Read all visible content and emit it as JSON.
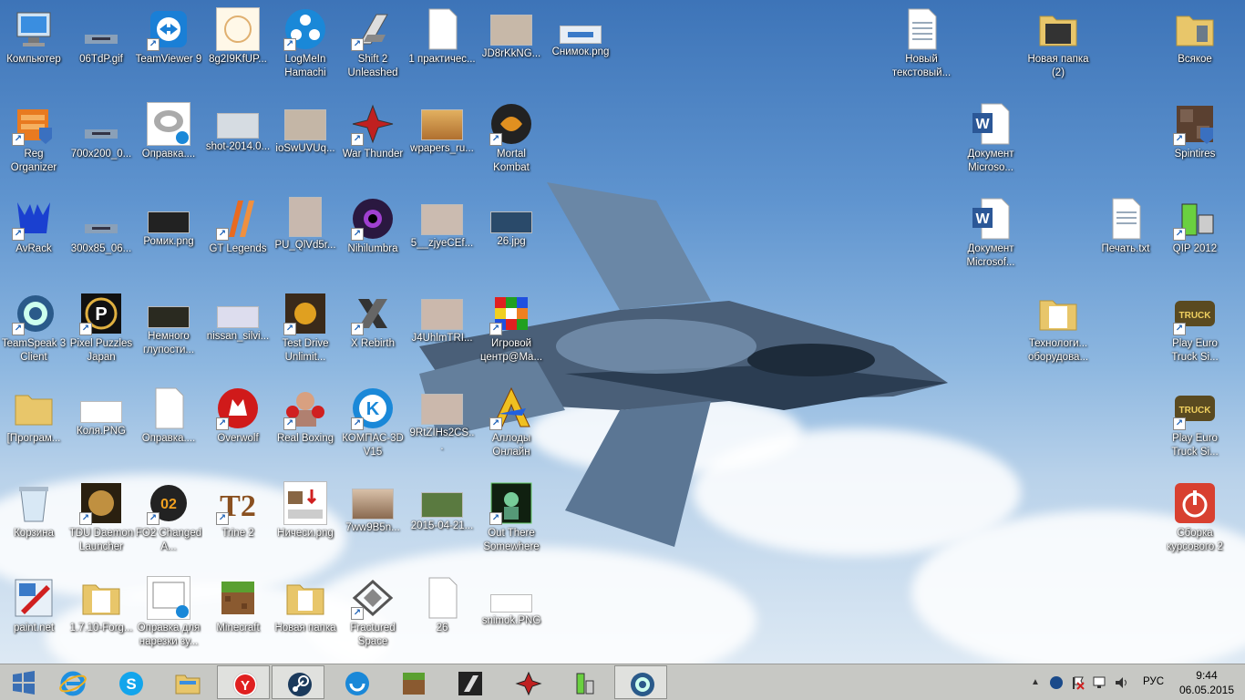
{
  "desktop": {
    "icons": [
      {
        "label": "Компьютер"
      },
      {
        "label": "06TdP.gif"
      },
      {
        "label": "TeamViewer 9"
      },
      {
        "label": "8g2I9KfUP..."
      },
      {
        "label": "LogMeIn Hamachi"
      },
      {
        "label": "Shift 2 Unleashed"
      },
      {
        "label": "1 практичес..."
      },
      {
        "label": "JD8rKkNG..."
      },
      {
        "label": "Снимок.png"
      },
      {
        "label": "Новый текстовый..."
      },
      {
        "label": "Новая папка (2)"
      },
      {
        "label": "Всякое"
      },
      {
        "label": "Reg Organizer"
      },
      {
        "label": "700x200_0..."
      },
      {
        "label": "Оправка...."
      },
      {
        "label": "shot-2014.0..."
      },
      {
        "label": "ioSwUVUq..."
      },
      {
        "label": "War Thunder"
      },
      {
        "label": "wpapers_ru..."
      },
      {
        "label": "Mortal Kombat"
      },
      {
        "label": "Документ Microso..."
      },
      {
        "label": "Spintires"
      },
      {
        "label": "AvRack"
      },
      {
        "label": "300x85_06..."
      },
      {
        "label": "Ромик.png"
      },
      {
        "label": "GT Legends"
      },
      {
        "label": "PU_QlVd5r..."
      },
      {
        "label": "Nihilumbra"
      },
      {
        "label": "5__zjyeCEf..."
      },
      {
        "label": "26.jpg"
      },
      {
        "label": "Документ Microsof..."
      },
      {
        "label": "Печать.txt"
      },
      {
        "label": "QIP 2012"
      },
      {
        "label": "TeamSpeak 3 Client"
      },
      {
        "label": "Pixel Puzzles Japan"
      },
      {
        "label": "Немного глупости..."
      },
      {
        "label": "nissan_silvi..."
      },
      {
        "label": "Test Drive Unlimit..."
      },
      {
        "label": "X Rebirth"
      },
      {
        "label": "J4UhlmTRI..."
      },
      {
        "label": "Игровой центр@Ma..."
      },
      {
        "label": "Технологи... оборудова..."
      },
      {
        "label": "Play Euro Truck Si..."
      },
      {
        "label": "[Програм..."
      },
      {
        "label": "Коля.PNG"
      },
      {
        "label": "Оправка...."
      },
      {
        "label": "Overwolf"
      },
      {
        "label": "Real Boxing"
      },
      {
        "label": "КОМПАС-3D V15"
      },
      {
        "label": "9RtZIHs2CS..."
      },
      {
        "label": "Аллоды Онлайн"
      },
      {
        "label": "Play Euro Truck Si..."
      },
      {
        "label": "Корзина"
      },
      {
        "label": "TDU Daemon Launcher"
      },
      {
        "label": "FO2 Changed A..."
      },
      {
        "label": "Trine 2"
      },
      {
        "label": "Ничеси.png"
      },
      {
        "label": "7ww9B5n..."
      },
      {
        "label": "2015-04-21..."
      },
      {
        "label": "Out There Somewhere"
      },
      {
        "label": "Сборка курсового 2"
      },
      {
        "label": "paint.net"
      },
      {
        "label": "1.7.10-Forg..."
      },
      {
        "label": "Оправка для нарезки зу..."
      },
      {
        "label": "Minecraft"
      },
      {
        "label": "Новая папка"
      },
      {
        "label": "Fractured Space"
      },
      {
        "label": "26"
      },
      {
        "label": "snimok.PNG"
      }
    ]
  },
  "taskbar": {
    "items": [
      {
        "name": "start",
        "icon": "windows-logo-icon"
      },
      {
        "name": "internet-explorer",
        "icon": "ie-icon"
      },
      {
        "name": "skype",
        "icon": "skype-icon"
      },
      {
        "name": "file-explorer",
        "icon": "folder-icon"
      },
      {
        "name": "yandex-browser",
        "icon": "yandex-icon"
      },
      {
        "name": "steam",
        "icon": "steam-icon"
      },
      {
        "name": "kompas",
        "icon": "kompas-icon"
      },
      {
        "name": "minecraft",
        "icon": "minecraft-icon"
      },
      {
        "name": "shift2",
        "icon": "shift2-icon"
      },
      {
        "name": "war-thunder",
        "icon": "war-thunder-icon"
      },
      {
        "name": "qip",
        "icon": "qip-icon"
      },
      {
        "name": "teamspeak",
        "icon": "teamspeak-icon"
      }
    ],
    "tray": {
      "language": "РУС",
      "time": "9:44",
      "date": "06.05.2015"
    }
  }
}
